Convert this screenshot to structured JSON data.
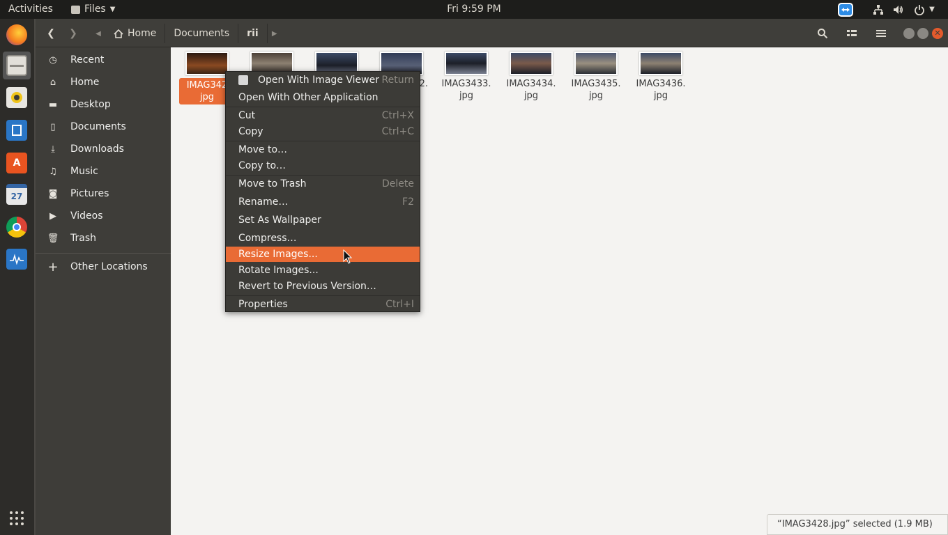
{
  "topbar": {
    "activities": "Activities",
    "app_name": "Files",
    "clock": "Fri  9:59 PM"
  },
  "dock": {
    "items": [
      "firefox",
      "files",
      "rhythmbox",
      "libreoffice-writer",
      "ubuntu-software",
      "calendar",
      "chrome",
      "system-monitor"
    ],
    "calendar_day": "27"
  },
  "pathbar": {
    "segments": [
      "Home",
      "Documents",
      "rii"
    ]
  },
  "sidebar": {
    "items": [
      {
        "label": "Recent",
        "icon": "clock-icon"
      },
      {
        "label": "Home",
        "icon": "home-icon"
      },
      {
        "label": "Desktop",
        "icon": "folder-icon"
      },
      {
        "label": "Documents",
        "icon": "document-icon"
      },
      {
        "label": "Downloads",
        "icon": "download-icon"
      },
      {
        "label": "Music",
        "icon": "music-icon"
      },
      {
        "label": "Pictures",
        "icon": "camera-icon"
      },
      {
        "label": "Videos",
        "icon": "video-icon"
      },
      {
        "label": "Trash",
        "icon": "trash-icon"
      },
      {
        "label": "Other Locations",
        "icon": "plus-icon"
      }
    ]
  },
  "files": [
    {
      "name1": "IMAG342",
      "name2": "jpg",
      "selected": true
    },
    {
      "name1": "",
      "name2": "",
      "selected": false
    },
    {
      "name1": "",
      "name2": "",
      "selected": false
    },
    {
      "name1": "2.",
      "name2": "",
      "selected": false
    },
    {
      "name1": "IMAG3433.",
      "name2": "jpg",
      "selected": false
    },
    {
      "name1": "IMAG3434.",
      "name2": "jpg",
      "selected": false
    },
    {
      "name1": "IMAG3435.",
      "name2": "jpg",
      "selected": false
    },
    {
      "name1": "IMAG3436.",
      "name2": "jpg",
      "selected": false
    }
  ],
  "context_menu": {
    "items": [
      {
        "label": "Open With Image Viewer",
        "accel": "Return"
      },
      {
        "label": "Open With Other Application",
        "accel": ""
      },
      {
        "label": "Cut",
        "accel": "Ctrl+X"
      },
      {
        "label": "Copy",
        "accel": "Ctrl+C"
      },
      {
        "label": "Move to…",
        "accel": ""
      },
      {
        "label": "Copy to…",
        "accel": ""
      },
      {
        "label": "Move to Trash",
        "accel": "Delete"
      },
      {
        "label": "Rename…",
        "accel": "F2"
      },
      {
        "label": "Set As Wallpaper",
        "accel": ""
      },
      {
        "label": "Compress…",
        "accel": ""
      },
      {
        "label": "Resize Images...",
        "accel": ""
      },
      {
        "label": "Rotate Images...",
        "accel": ""
      },
      {
        "label": "Revert to Previous Version…",
        "accel": ""
      },
      {
        "label": "Properties",
        "accel": "Ctrl+I"
      }
    ],
    "highlighted_index": 10
  },
  "status": {
    "text": "“IMAG3428.jpg” selected  (1.9 MB)"
  },
  "colors": {
    "accent": "#e96b35",
    "headerbar": "#3f3e3a",
    "sidebar": "#3e3d39"
  }
}
